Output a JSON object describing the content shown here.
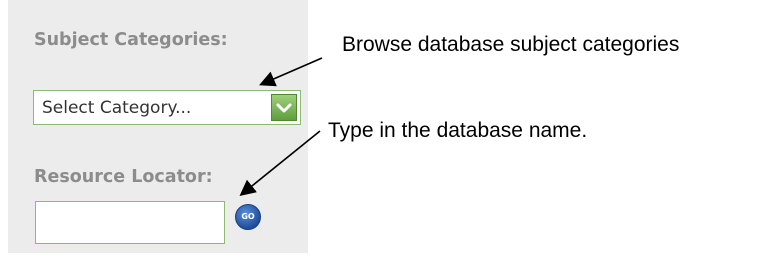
{
  "sidebar": {
    "subject_heading": "Subject Categories:",
    "category_select": {
      "selected": "Select Category..."
    },
    "resource_heading": "Resource Locator:",
    "resource_input": {
      "value": ""
    },
    "go_label": "GO"
  },
  "annotations": {
    "browse_note": "Browse database subject categories",
    "type_note": "Type in the database name."
  },
  "colors": {
    "panel": "#ececec",
    "heading": "#8c8c8c",
    "field_border": "#8fb870",
    "dropdown_button": "#6fae4a",
    "go_button": "#1f4e9e"
  }
}
